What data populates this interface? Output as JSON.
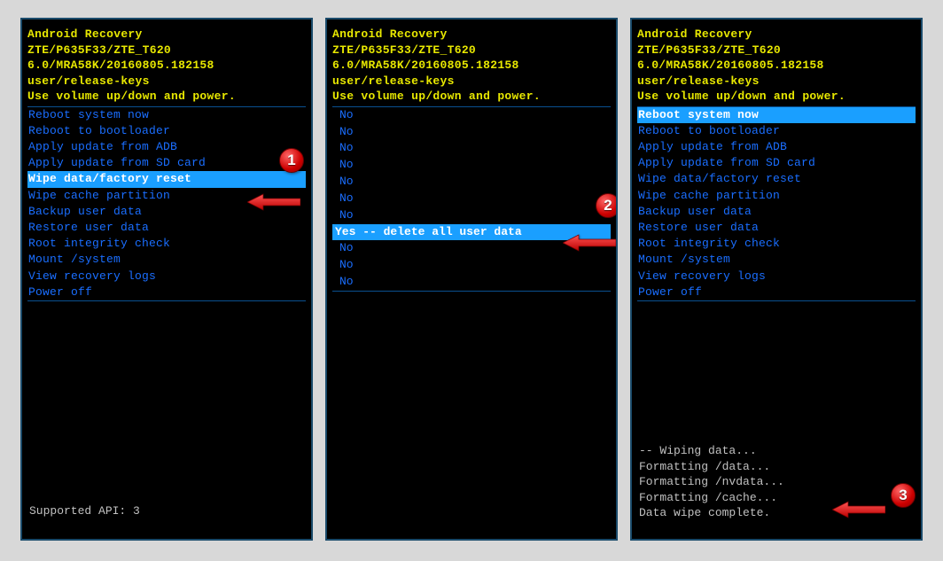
{
  "header": {
    "title": "Android Recovery",
    "device": "ZTE/P635F33/ZTE_T620",
    "build": "6.0/MRA58K/20160805.182158",
    "keys": "user/release-keys",
    "instruction": "Use volume up/down and power."
  },
  "screen1": {
    "menu": [
      "Reboot system now",
      "Reboot to bootloader",
      "Apply update from ADB",
      "Apply update from SD card",
      "Wipe data/factory reset",
      "Wipe cache partition",
      "Backup user data",
      "Restore user data",
      "Root integrity check",
      "Mount /system",
      "View recovery logs",
      "Power off"
    ],
    "selectedIndex": 4,
    "footer": "Supported API: 3"
  },
  "screen2": {
    "items": [
      "No",
      "No",
      "No",
      "No",
      "No",
      "No",
      "No",
      "Yes -- delete all user data",
      "No",
      "No",
      "No"
    ],
    "selectedIndex": 7
  },
  "screen3": {
    "menu": [
      "Reboot system now",
      "Reboot to bootloader",
      "Apply update from ADB",
      "Apply update from SD card",
      "Wipe data/factory reset",
      "Wipe cache partition",
      "Backup user data",
      "Restore user data",
      "Root integrity check",
      "Mount /system",
      "View recovery logs",
      "Power off"
    ],
    "selectedIndex": 0,
    "log": [
      "-- Wiping data...",
      "Formatting /data...",
      "Formatting /nvdata...",
      "Formatting /cache...",
      "Data wipe complete."
    ]
  },
  "badges": {
    "b1": "1",
    "b2": "2",
    "b3": "3"
  }
}
